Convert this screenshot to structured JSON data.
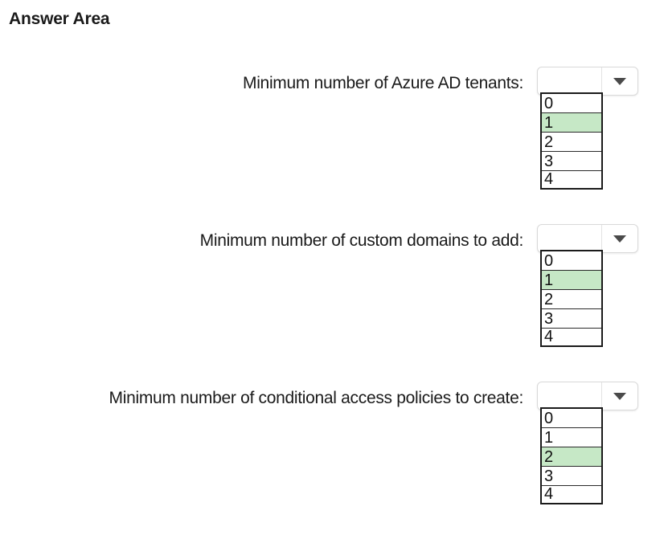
{
  "page": {
    "title": "Answer Area"
  },
  "questions": [
    {
      "label": "Minimum number of Azure AD tenants:",
      "options": [
        "0",
        "1",
        "2",
        "3",
        "4"
      ],
      "selected_index": 1
    },
    {
      "label": "Minimum number of custom domains to add:",
      "options": [
        "0",
        "1",
        "2",
        "3",
        "4"
      ],
      "selected_index": 1
    },
    {
      "label": "Minimum number of conditional access policies to create:",
      "options": [
        "0",
        "1",
        "2",
        "3",
        "4"
      ],
      "selected_index": 2
    }
  ],
  "icons": {
    "dropdown": "chevron-down-icon"
  },
  "colors": {
    "selected_option": "#c6e8c6",
    "list_border": "#1a1a1a"
  }
}
